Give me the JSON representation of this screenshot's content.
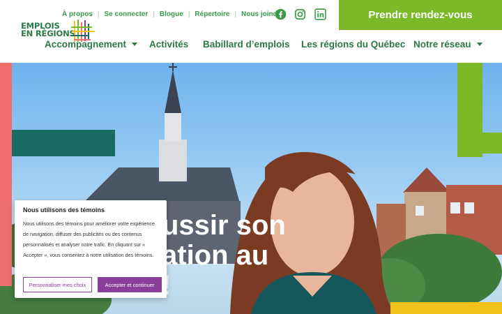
{
  "brand": {
    "logo_line1": "EMPLOIS",
    "logo_line2": "EN RÉGIONS",
    "green": "#7bb929",
    "dark_green": "#2b7a45",
    "coral": "#ef6f6c",
    "teal": "#1a6b66",
    "yellow": "#f4c21a",
    "purple": "#8b3e9a"
  },
  "utility_nav": {
    "items": [
      "À propos",
      "Se connecter",
      "Blogue",
      "Répertoire",
      "Nous joindre"
    ]
  },
  "social": {
    "icons": [
      "facebook-icon",
      "instagram-icon",
      "linkedin-icon"
    ]
  },
  "cta": {
    "label": "Prendre rendez-vous"
  },
  "main_nav": {
    "items": [
      {
        "label": "Accompagnement",
        "dropdown": true
      },
      {
        "label": "Activités",
        "dropdown": false
      },
      {
        "label": "Babillard d’emplois",
        "dropdown": false
      },
      {
        "label": "Les régions du Québec",
        "dropdown": false
      },
      {
        "label": "Notre réseau",
        "dropdown": true
      }
    ]
  },
  "hero": {
    "line1": "ussir son",
    "line2": "ation au",
    "line3": "!"
  },
  "cookie_banner": {
    "title": "Nous utilisons des témoins ",
    "body": "Nous utilisons des témoins pour améliorer votre expérience de navigation, diffuser des publicités ou des contenus personnalisés et analyser notre trafic. En cliquant sur « Accepter », vous consentez à notre utilisation des témoins.",
    "customize_label": "Personnaliser mes choix",
    "accept_label": "Accepter et continuer"
  }
}
